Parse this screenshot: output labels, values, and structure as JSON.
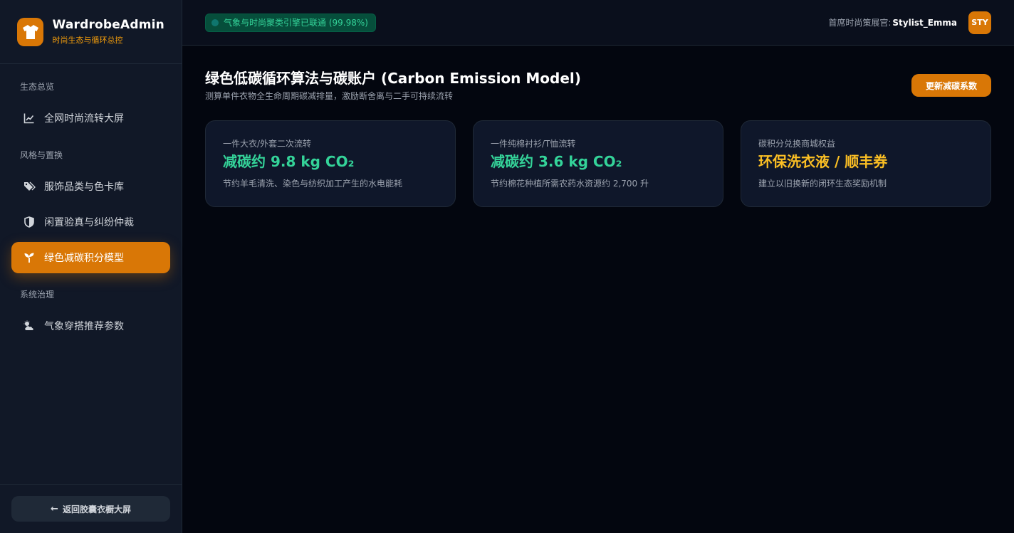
{
  "brand": {
    "title": "WardrobeAdmin",
    "subtitle": "时尚生态与循环总控",
    "logo_icon": "shirt-icon"
  },
  "nav": {
    "groups": [
      {
        "title": "生态总览",
        "items": [
          {
            "label": "全网时尚流转大屏",
            "icon": "chart-line-icon",
            "active": false
          }
        ]
      },
      {
        "title": "风格与置换",
        "items": [
          {
            "label": "服饰品类与色卡库",
            "icon": "tags-icon",
            "active": false
          },
          {
            "label": "闲置验真与纠纷仲裁",
            "icon": "shield-icon",
            "active": false
          },
          {
            "label": "绿色减碳积分模型",
            "icon": "seedling-icon",
            "active": true
          }
        ]
      },
      {
        "title": "系统治理",
        "items": [
          {
            "label": "气象穿搭推荐参数",
            "icon": "cloud-sun-icon",
            "active": false
          }
        ]
      }
    ]
  },
  "footer": {
    "back_label": "返回胶囊衣橱大屏",
    "back_icon": "arrow-left-icon"
  },
  "topbar": {
    "status_text": "气象与时尚聚类引擎已联通 (99.98%)",
    "user_label": "首席时尚策展官:",
    "user_name": "Stylist_Emma",
    "avatar_text": "STY"
  },
  "page": {
    "title": "绿色低碳循环算法与碳账户 (Carbon Emission Model)",
    "subtitle": "测算单件衣物全生命周期碳减排量，激励断舍离与二手可持续流转",
    "action_label": "更新减碳系数"
  },
  "cards": [
    {
      "label": "一件大衣/外套二次流转",
      "value": "减碳约 9.8 kg CO₂",
      "desc": "节约羊毛清洗、染色与纺织加工产生的水电能耗",
      "color": "#34d399"
    },
    {
      "label": "一件纯棉衬衫/T恤流转",
      "value": "减碳约 3.6 kg CO₂",
      "desc": "节约棉花种植所需农药水资源约 2,700 升",
      "color": "#34d399"
    },
    {
      "label": "碳积分兑换商城权益",
      "value": "环保洗衣液 / 顺丰券",
      "desc": "建立以旧换新的闭环生态奖励机制",
      "color": "#fbbf24"
    }
  ],
  "colors": {
    "accent": "#d97706",
    "success": "#34d399",
    "highlight": "#fbbf24",
    "background": "#03060f",
    "sidebar": "#111827"
  }
}
